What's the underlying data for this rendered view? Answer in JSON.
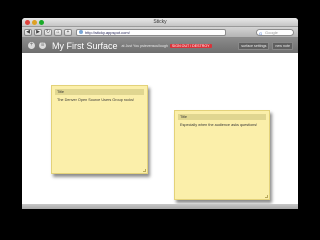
{
  "window": {
    "title": "Sticky"
  },
  "toolbar": {
    "back_icon": "back-arrow-icon",
    "forward_icon": "forward-arrow-icon",
    "url": "http://sticky.appspot.com/",
    "search_placeholder": "Google"
  },
  "app": {
    "title": "My First Surface",
    "subtitle": "at Just You  pstevenscullough",
    "signout_label": "SIGN OUT / DESTROY",
    "buttons": [
      {
        "label": "surface settings"
      },
      {
        "label": "new note"
      }
    ]
  },
  "notes": [
    {
      "title": "Title",
      "body": "The Denver Open Source Users Group rocks!"
    },
    {
      "title": "Title",
      "body": "Especially when the audience asks questions!"
    }
  ]
}
